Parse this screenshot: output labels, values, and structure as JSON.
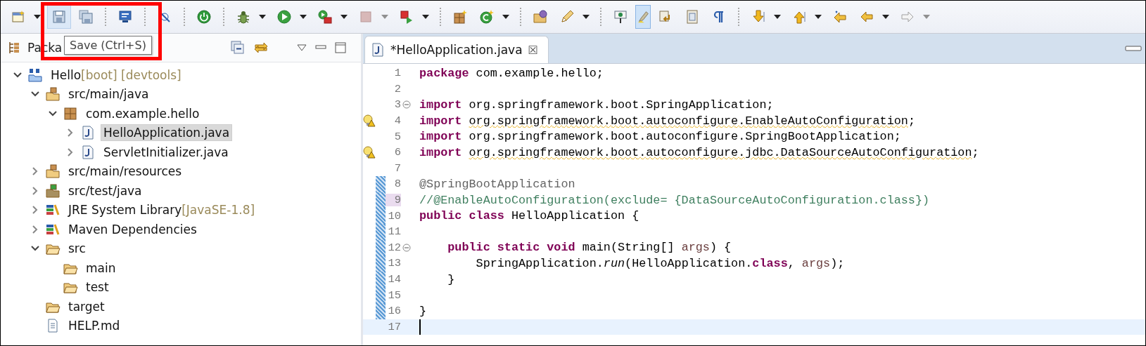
{
  "toolbar": {
    "save_hovered": true,
    "highlight_toggle_on": true,
    "tooltip": "Save (Ctrl+S)",
    "annotation_frame": true
  },
  "explorer": {
    "title": "Packa",
    "tree": [
      {
        "label": "Hello",
        "decoration": "[boot] [devtools]",
        "kind": "project",
        "expanded": true,
        "selected": false,
        "children": [
          {
            "label": "src/main/java",
            "kind": "source-folder",
            "expanded": true,
            "selected": false,
            "children": [
              {
                "label": "com.example.hello",
                "kind": "package",
                "expanded": true,
                "selected": false,
                "children": [
                  {
                    "label": "HelloApplication.java",
                    "kind": "java-file",
                    "expanded": false,
                    "selected": true
                  },
                  {
                    "label": "ServletInitializer.java",
                    "kind": "java-file",
                    "expanded": false,
                    "selected": false
                  }
                ]
              }
            ]
          },
          {
            "label": "src/main/resources",
            "kind": "source-folder",
            "expanded": false,
            "selected": false
          },
          {
            "label": "src/test/java",
            "kind": "test-source-folder",
            "expanded": false,
            "selected": false
          },
          {
            "label": "JRE System Library",
            "decoration": "[JavaSE-1.8]",
            "kind": "library",
            "expanded": false,
            "selected": false
          },
          {
            "label": "Maven Dependencies",
            "kind": "library",
            "expanded": false,
            "selected": false
          },
          {
            "label": "src",
            "kind": "folder",
            "expanded": true,
            "selected": false,
            "children": [
              {
                "label": "main",
                "kind": "folder",
                "selected": false
              },
              {
                "label": "test",
                "kind": "folder",
                "selected": false
              }
            ]
          },
          {
            "label": "target",
            "kind": "folder",
            "selected": false
          },
          {
            "label": "HELP.md",
            "kind": "file",
            "selected": false
          }
        ]
      }
    ]
  },
  "editor": {
    "tabs": [
      {
        "label": "*HelloApplication.java",
        "selected": true,
        "close": "☒"
      }
    ],
    "lines": [
      {
        "n": "1",
        "fold": false,
        "warning": false,
        "changed": false,
        "highlighted": false,
        "current": false,
        "tokens": [
          {
            "t": "package",
            "kind": "kw"
          },
          {
            "t": " com.example.hello;",
            "kind": "plain"
          }
        ]
      },
      {
        "n": "2",
        "fold": false,
        "warning": false,
        "changed": false,
        "highlighted": false,
        "current": false
      },
      {
        "n": "3",
        "fold": true,
        "warning": false,
        "changed": false,
        "highlighted": false,
        "current": false,
        "tokens": [
          {
            "t": "import",
            "kind": "kw"
          },
          {
            "t": " org.springframework.boot.SpringApplication;",
            "kind": "plain"
          }
        ]
      },
      {
        "n": "4",
        "fold": false,
        "warning": true,
        "changed": false,
        "highlighted": false,
        "current": false,
        "tokens": [
          {
            "t": "import ",
            "kind": "kw"
          },
          {
            "t": "org.springframework.boot.autoconfigure.EnableAutoConfiguration",
            "kind": "warn"
          },
          {
            "t": ";",
            "kind": "plain"
          }
        ]
      },
      {
        "n": "5",
        "fold": false,
        "warning": false,
        "changed": false,
        "highlighted": false,
        "current": false,
        "tokens": [
          {
            "t": "import",
            "kind": "kw"
          },
          {
            "t": " org.springframework.boot.autoconfigure.SpringBootApplication;",
            "kind": "plain"
          }
        ]
      },
      {
        "n": "6",
        "fold": false,
        "warning": true,
        "changed": false,
        "highlighted": false,
        "current": false,
        "tokens": [
          {
            "t": "import ",
            "kind": "kw"
          },
          {
            "t": "org.springframework.boot.autoconfigure.jdbc.DataSourceAutoConfiguration",
            "kind": "warn"
          },
          {
            "t": ";",
            "kind": "plain"
          }
        ]
      },
      {
        "n": "7",
        "fold": false,
        "warning": false,
        "changed": false,
        "highlighted": false,
        "current": false
      },
      {
        "n": "8",
        "fold": false,
        "warning": false,
        "changed": true,
        "highlighted": false,
        "current": false,
        "tokens": [
          {
            "t": "@SpringBootApplication",
            "kind": "ann"
          }
        ]
      },
      {
        "n": "9",
        "fold": false,
        "warning": false,
        "changed": true,
        "highlighted": true,
        "current": false,
        "tokens": [
          {
            "t": "//@EnableAutoConfiguration(exclude= {DataSourceAutoConfiguration.class})",
            "kind": "comment"
          }
        ]
      },
      {
        "n": "10",
        "fold": false,
        "warning": false,
        "changed": true,
        "highlighted": false,
        "current": false,
        "tokens": [
          {
            "t": "public class",
            "kind": "kw"
          },
          {
            "t": " HelloApplication {",
            "kind": "plain"
          }
        ]
      },
      {
        "n": "11",
        "fold": false,
        "warning": false,
        "changed": true,
        "highlighted": false,
        "current": false
      },
      {
        "n": "12",
        "fold": true,
        "warning": false,
        "changed": true,
        "highlighted": false,
        "current": false,
        "tokens": [
          {
            "t": "    public static void",
            "kind": "kw"
          },
          {
            "t": " main(String[] ",
            "kind": "plain"
          },
          {
            "t": "args",
            "kind": "var"
          },
          {
            "t": ") {",
            "kind": "plain"
          }
        ]
      },
      {
        "n": "13",
        "fold": false,
        "warning": false,
        "changed": true,
        "highlighted": false,
        "current": false,
        "tokens": [
          {
            "t": "        SpringApplication.",
            "kind": "plain"
          },
          {
            "t": "run",
            "kind": "italic"
          },
          {
            "t": "(HelloApplication.",
            "kind": "plain"
          },
          {
            "t": "class",
            "kind": "kw"
          },
          {
            "t": ", ",
            "kind": "plain"
          },
          {
            "t": "args",
            "kind": "var"
          },
          {
            "t": ");",
            "kind": "plain"
          }
        ]
      },
      {
        "n": "14",
        "fold": false,
        "warning": false,
        "changed": true,
        "highlighted": false,
        "current": false,
        "tokens": [
          {
            "t": "    }",
            "kind": "plain"
          }
        ]
      },
      {
        "n": "15",
        "fold": false,
        "warning": false,
        "changed": true,
        "highlighted": false,
        "current": false
      },
      {
        "n": "16",
        "fold": false,
        "warning": false,
        "changed": true,
        "highlighted": false,
        "current": false,
        "tokens": [
          {
            "t": "}",
            "kind": "plain"
          }
        ]
      },
      {
        "n": "17",
        "fold": false,
        "warning": false,
        "changed": false,
        "highlighted": false,
        "current": true
      }
    ]
  }
}
